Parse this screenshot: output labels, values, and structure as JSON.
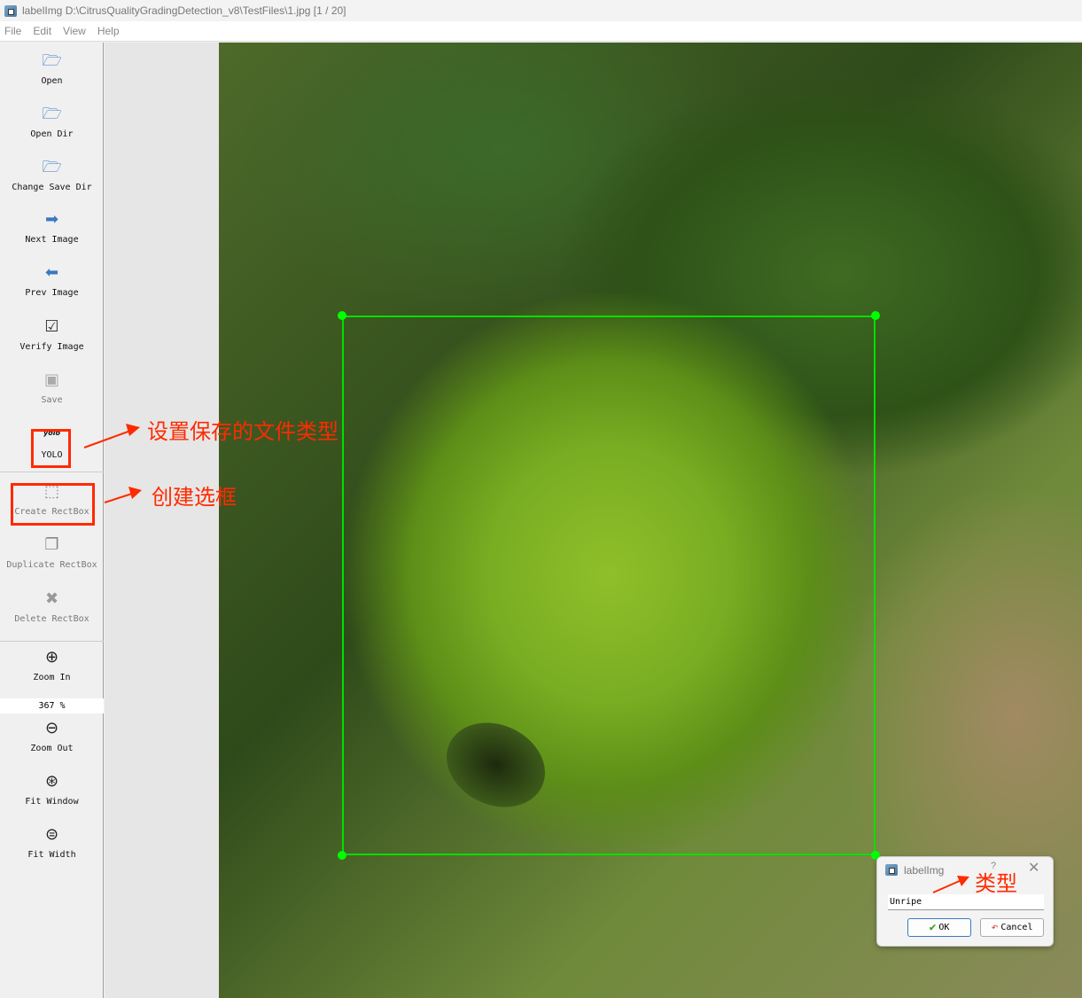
{
  "window": {
    "title": "labelImg D:\\CitrusQualityGradingDetection_v8\\TestFiles\\1.jpg [1 / 20]"
  },
  "menu": [
    "File",
    "Edit",
    "View",
    "Help"
  ],
  "toolbar": {
    "open": "Open",
    "open_dir": "Open Dir",
    "change_save_dir": "Change Save Dir",
    "next_image": "Next Image",
    "prev_image": "Prev Image",
    "verify_image": "Verify Image",
    "save": "Save",
    "format_icon_text": "yolo",
    "format": "YOLO",
    "create_rectbox": "Create RectBox",
    "duplicate_rectbox": "Duplicate RectBox",
    "delete_rectbox": "Delete RectBox",
    "zoom_in": "Zoom In",
    "zoom_value": "367 %",
    "zoom_out": "Zoom Out",
    "fit_window": "Fit Window",
    "fit_width": "Fit Width"
  },
  "annotations": {
    "save_format": "设置保存的文件类型",
    "create_box": "创建选框",
    "label_type": "类型"
  },
  "dialog": {
    "title": "labelImg",
    "help": "?",
    "label_value": "Unripe",
    "ok": "OK",
    "cancel": "Cancel"
  },
  "colors": {
    "bbox": "#00e000",
    "annotation": "#ff2a00"
  }
}
